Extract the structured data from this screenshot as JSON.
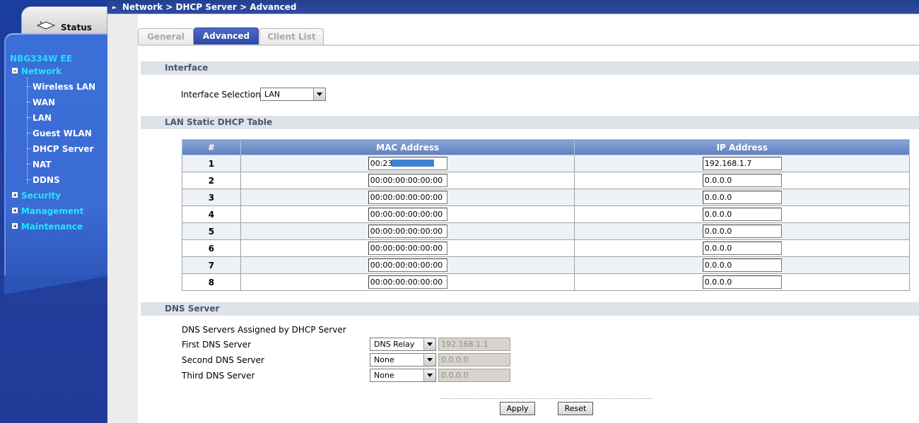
{
  "breadcrumb": "Network > DHCP Server > Advanced",
  "status_tab": {
    "label": "Status",
    "icon": "router-icon"
  },
  "sidebar": {
    "model": "NBG334W EE",
    "categories": [
      {
        "label": "Network",
        "expanded": true
      },
      {
        "label": "Security",
        "expanded": false
      },
      {
        "label": "Management",
        "expanded": false
      },
      {
        "label": "Maintenance",
        "expanded": false
      }
    ],
    "network_items": [
      "Wireless LAN",
      "WAN",
      "LAN",
      "Guest WLAN",
      "DHCP Server",
      "NAT",
      "DDNS"
    ]
  },
  "tabs": [
    {
      "label": "General",
      "active": false
    },
    {
      "label": "Advanced",
      "active": true
    },
    {
      "label": "Client List",
      "active": false
    }
  ],
  "interface": {
    "section_title": "Interface",
    "label": "Interface Selection",
    "value": "LAN"
  },
  "static_table": {
    "section_title": "LAN Static DHCP Table",
    "headers": [
      "#",
      "MAC Address",
      "IP Address"
    ],
    "rows": [
      {
        "num": "1",
        "mac": "00:23:",
        "ip": "192.168.1.7"
      },
      {
        "num": "2",
        "mac": "00:00:00:00:00:00",
        "ip": "0.0.0.0"
      },
      {
        "num": "3",
        "mac": "00:00:00:00:00:00",
        "ip": "0.0.0.0"
      },
      {
        "num": "4",
        "mac": "00:00:00:00:00:00",
        "ip": "0.0.0.0"
      },
      {
        "num": "5",
        "mac": "00:00:00:00:00:00",
        "ip": "0.0.0.0"
      },
      {
        "num": "6",
        "mac": "00:00:00:00:00:00",
        "ip": "0.0.0.0"
      },
      {
        "num": "7",
        "mac": "00:00:00:00:00:00",
        "ip": "0.0.0.0"
      },
      {
        "num": "8",
        "mac": "00:00:00:00:00:00",
        "ip": "0.0.0.0"
      }
    ]
  },
  "dns": {
    "section_title": "DNS Server",
    "assigned_label": "DNS Servers Assigned by DHCP Server",
    "servers": [
      {
        "label": "First DNS Server",
        "mode": "DNS Relay",
        "address": "192.168.1.1"
      },
      {
        "label": "Second DNS Server",
        "mode": "None",
        "address": "0.0.0.0"
      },
      {
        "label": "Third DNS Server",
        "mode": "None",
        "address": "0.0.0.0"
      }
    ]
  },
  "buttons": {
    "apply": "Apply",
    "reset": "Reset"
  },
  "colors": {
    "sidebar_bg": "#233f9c",
    "menu_panel": "#3b6bd4",
    "category_text": "#22e6ff",
    "active_tab": "#2c48a6",
    "table_header": "#6f8fcb",
    "section_bar": "#dde3e8"
  }
}
